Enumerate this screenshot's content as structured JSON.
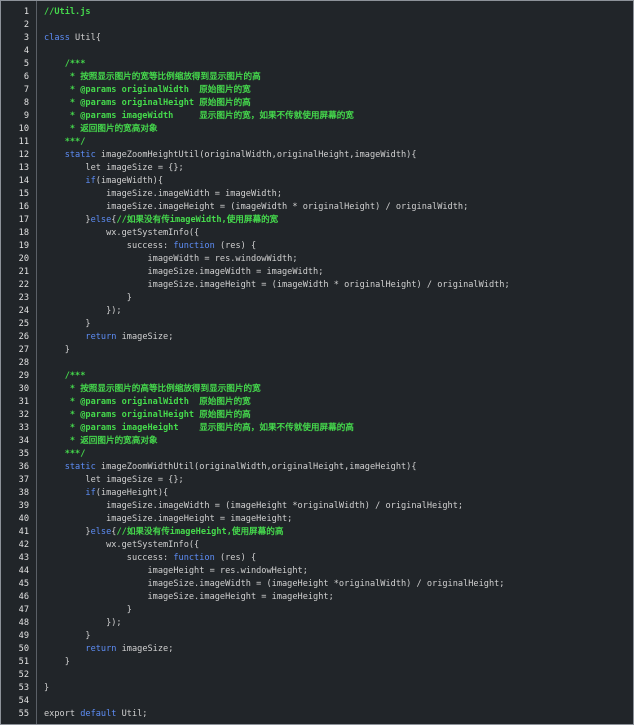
{
  "colors": {
    "background": "#212529",
    "frame_border": "#8d9299",
    "gutter_border": "#5b6067",
    "line_number": "#e2e2e2",
    "plain": "#d0d0d0",
    "keyword": "#5d8df5",
    "comment": "#45d94c"
  },
  "lines": [
    {
      "n": 1,
      "tokens": [
        {
          "type": "comment",
          "text": "//Util.js"
        }
      ]
    },
    {
      "n": 2,
      "tokens": []
    },
    {
      "n": 3,
      "tokens": [
        {
          "type": "keyword",
          "text": "class"
        },
        {
          "type": "plain",
          "text": " Util{"
        }
      ]
    },
    {
      "n": 4,
      "tokens": []
    },
    {
      "n": 5,
      "tokens": [
        {
          "type": "comment",
          "text": "    /***"
        }
      ]
    },
    {
      "n": 6,
      "tokens": [
        {
          "type": "comment",
          "text": "     * 按照显示图片的宽等比例缩放得到显示图片的高"
        }
      ]
    },
    {
      "n": 7,
      "tokens": [
        {
          "type": "comment",
          "text": "     * @params originalWidth  原始图片的宽"
        }
      ]
    },
    {
      "n": 8,
      "tokens": [
        {
          "type": "comment",
          "text": "     * @params originalHeight 原始图片的高"
        }
      ]
    },
    {
      "n": 9,
      "tokens": [
        {
          "type": "comment",
          "text": "     * @params imageWidth     显示图片的宽，如果不传就使用屏幕的宽"
        }
      ]
    },
    {
      "n": 10,
      "tokens": [
        {
          "type": "comment",
          "text": "     * 返回图片的宽高对象"
        }
      ]
    },
    {
      "n": 11,
      "tokens": [
        {
          "type": "comment",
          "text": "    ***/"
        }
      ]
    },
    {
      "n": 12,
      "tokens": [
        {
          "type": "plain",
          "text": "    "
        },
        {
          "type": "keyword",
          "text": "static"
        },
        {
          "type": "plain",
          "text": " imageZoomHeightUtil(originalWidth,originalHeight,imageWidth){"
        }
      ]
    },
    {
      "n": 13,
      "tokens": [
        {
          "type": "plain",
          "text": "        let imageSize = {};"
        }
      ]
    },
    {
      "n": 14,
      "tokens": [
        {
          "type": "plain",
          "text": "        "
        },
        {
          "type": "keyword",
          "text": "if"
        },
        {
          "type": "plain",
          "text": "(imageWidth){"
        }
      ]
    },
    {
      "n": 15,
      "tokens": [
        {
          "type": "plain",
          "text": "            imageSize.imageWidth = imageWidth;"
        }
      ]
    },
    {
      "n": 16,
      "tokens": [
        {
          "type": "plain",
          "text": "            imageSize.imageHeight = (imageWidth * originalHeight) / originalWidth;"
        }
      ]
    },
    {
      "n": 17,
      "tokens": [
        {
          "type": "plain",
          "text": "        }"
        },
        {
          "type": "keyword",
          "text": "else"
        },
        {
          "type": "plain",
          "text": "{"
        },
        {
          "type": "comment",
          "text": "//如果没有传imageWidth,使用屏幕的宽"
        }
      ]
    },
    {
      "n": 18,
      "tokens": [
        {
          "type": "plain",
          "text": "            wx.getSystemInfo({"
        }
      ]
    },
    {
      "n": 19,
      "tokens": [
        {
          "type": "plain",
          "text": "                success: "
        },
        {
          "type": "keyword",
          "text": "function"
        },
        {
          "type": "plain",
          "text": " (res) {"
        }
      ]
    },
    {
      "n": 20,
      "tokens": [
        {
          "type": "plain",
          "text": "                    imageWidth = res.windowWidth;"
        }
      ]
    },
    {
      "n": 21,
      "tokens": [
        {
          "type": "plain",
          "text": "                    imageSize.imageWidth = imageWidth;"
        }
      ]
    },
    {
      "n": 22,
      "tokens": [
        {
          "type": "plain",
          "text": "                    imageSize.imageHeight = (imageWidth * originalHeight) / originalWidth;"
        }
      ]
    },
    {
      "n": 23,
      "tokens": [
        {
          "type": "plain",
          "text": "                }"
        }
      ]
    },
    {
      "n": 24,
      "tokens": [
        {
          "type": "plain",
          "text": "            });"
        }
      ]
    },
    {
      "n": 25,
      "tokens": [
        {
          "type": "plain",
          "text": "        }"
        }
      ]
    },
    {
      "n": 26,
      "tokens": [
        {
          "type": "plain",
          "text": "        "
        },
        {
          "type": "keyword",
          "text": "return"
        },
        {
          "type": "plain",
          "text": " imageSize;"
        }
      ]
    },
    {
      "n": 27,
      "tokens": [
        {
          "type": "plain",
          "text": "    }"
        }
      ]
    },
    {
      "n": 28,
      "tokens": []
    },
    {
      "n": 29,
      "tokens": [
        {
          "type": "comment",
          "text": "    /***"
        }
      ]
    },
    {
      "n": 30,
      "tokens": [
        {
          "type": "comment",
          "text": "     * 按照显示图片的高等比例缩放得到显示图片的宽"
        }
      ]
    },
    {
      "n": 31,
      "tokens": [
        {
          "type": "comment",
          "text": "     * @params originalWidth  原始图片的宽"
        }
      ]
    },
    {
      "n": 32,
      "tokens": [
        {
          "type": "comment",
          "text": "     * @params originalHeight 原始图片的高"
        }
      ]
    },
    {
      "n": 33,
      "tokens": [
        {
          "type": "comment",
          "text": "     * @params imageHeight    显示图片的高，如果不传就使用屏幕的高"
        }
      ]
    },
    {
      "n": 34,
      "tokens": [
        {
          "type": "comment",
          "text": "     * 返回图片的宽高对象"
        }
      ]
    },
    {
      "n": 35,
      "tokens": [
        {
          "type": "comment",
          "text": "    ***/"
        }
      ]
    },
    {
      "n": 36,
      "tokens": [
        {
          "type": "plain",
          "text": "    "
        },
        {
          "type": "keyword",
          "text": "static"
        },
        {
          "type": "plain",
          "text": " imageZoomWidthUtil(originalWidth,originalHeight,imageHeight){"
        }
      ]
    },
    {
      "n": 37,
      "tokens": [
        {
          "type": "plain",
          "text": "        let imageSize = {};"
        }
      ]
    },
    {
      "n": 38,
      "tokens": [
        {
          "type": "plain",
          "text": "        "
        },
        {
          "type": "keyword",
          "text": "if"
        },
        {
          "type": "plain",
          "text": "(imageHeight){"
        }
      ]
    },
    {
      "n": 39,
      "tokens": [
        {
          "type": "plain",
          "text": "            imageSize.imageWidth = (imageHeight *originalWidth) / originalHeight;"
        }
      ]
    },
    {
      "n": 40,
      "tokens": [
        {
          "type": "plain",
          "text": "            imageSize.imageHeight = imageHeight;"
        }
      ]
    },
    {
      "n": 41,
      "tokens": [
        {
          "type": "plain",
          "text": "        }"
        },
        {
          "type": "keyword",
          "text": "else"
        },
        {
          "type": "plain",
          "text": "{"
        },
        {
          "type": "comment",
          "text": "//如果没有传imageHeight,使用屏幕的高"
        }
      ]
    },
    {
      "n": 42,
      "tokens": [
        {
          "type": "plain",
          "text": "            wx.getSystemInfo({"
        }
      ]
    },
    {
      "n": 43,
      "tokens": [
        {
          "type": "plain",
          "text": "                success: "
        },
        {
          "type": "keyword",
          "text": "function"
        },
        {
          "type": "plain",
          "text": " (res) {"
        }
      ]
    },
    {
      "n": 44,
      "tokens": [
        {
          "type": "plain",
          "text": "                    imageHeight = res.windowHeight;"
        }
      ]
    },
    {
      "n": 45,
      "tokens": [
        {
          "type": "plain",
          "text": "                    imageSize.imageWidth = (imageHeight *originalWidth) / originalHeight;"
        }
      ]
    },
    {
      "n": 46,
      "tokens": [
        {
          "type": "plain",
          "text": "                    imageSize.imageHeight = imageHeight;"
        }
      ]
    },
    {
      "n": 47,
      "tokens": [
        {
          "type": "plain",
          "text": "                }"
        }
      ]
    },
    {
      "n": 48,
      "tokens": [
        {
          "type": "plain",
          "text": "            });"
        }
      ]
    },
    {
      "n": 49,
      "tokens": [
        {
          "type": "plain",
          "text": "        }"
        }
      ]
    },
    {
      "n": 50,
      "tokens": [
        {
          "type": "plain",
          "text": "        "
        },
        {
          "type": "keyword",
          "text": "return"
        },
        {
          "type": "plain",
          "text": " imageSize;"
        }
      ]
    },
    {
      "n": 51,
      "tokens": [
        {
          "type": "plain",
          "text": "    }"
        }
      ]
    },
    {
      "n": 52,
      "tokens": []
    },
    {
      "n": 53,
      "tokens": [
        {
          "type": "plain",
          "text": "}"
        }
      ]
    },
    {
      "n": 54,
      "tokens": []
    },
    {
      "n": 55,
      "tokens": [
        {
          "type": "plain",
          "text": "export "
        },
        {
          "type": "keyword",
          "text": "default"
        },
        {
          "type": "plain",
          "text": " Util;"
        }
      ]
    }
  ]
}
